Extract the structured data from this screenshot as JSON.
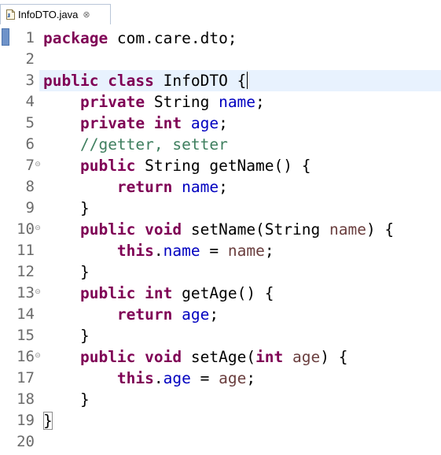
{
  "tab": {
    "label": "InfoDTO.java",
    "close_glyph": "⊗",
    "icon": "java-file-icon"
  },
  "editor": {
    "colors": {
      "keyword": "#7f0055",
      "field": "#0000c0",
      "parameter": "#6a3e3e",
      "comment": "#3f7f5f",
      "current_line": "#e8f2fe"
    },
    "lines": [
      {
        "number": "1",
        "tokens": [
          {
            "t": "package",
            "c": "keyword"
          },
          {
            "t": " com.care.dto;",
            "c": "plain"
          }
        ]
      },
      {
        "number": "2",
        "tokens": []
      },
      {
        "number": "3",
        "tokens": [
          {
            "t": "public",
            "c": "keyword"
          },
          {
            "t": " ",
            "c": "plain"
          },
          {
            "t": "class",
            "c": "keyword"
          },
          {
            "t": " InfoDTO {",
            "c": "plain"
          }
        ],
        "current": true,
        "caret": true
      },
      {
        "number": "4",
        "tokens": [
          {
            "t": "    ",
            "c": "plain"
          },
          {
            "t": "private",
            "c": "keyword"
          },
          {
            "t": " String ",
            "c": "plain"
          },
          {
            "t": "name",
            "c": "field"
          },
          {
            "t": ";",
            "c": "plain"
          }
        ]
      },
      {
        "number": "5",
        "tokens": [
          {
            "t": "    ",
            "c": "plain"
          },
          {
            "t": "private",
            "c": "keyword"
          },
          {
            "t": " ",
            "c": "plain"
          },
          {
            "t": "int",
            "c": "keyword"
          },
          {
            "t": " ",
            "c": "plain"
          },
          {
            "t": "age",
            "c": "field"
          },
          {
            "t": ";",
            "c": "plain"
          }
        ]
      },
      {
        "number": "6",
        "tokens": [
          {
            "t": "    ",
            "c": "plain"
          },
          {
            "t": "//getter, setter",
            "c": "comment"
          }
        ]
      },
      {
        "number": "7",
        "fold": true,
        "tokens": [
          {
            "t": "    ",
            "c": "plain"
          },
          {
            "t": "public",
            "c": "keyword"
          },
          {
            "t": " String getName() {",
            "c": "plain"
          }
        ]
      },
      {
        "number": "8",
        "tokens": [
          {
            "t": "        ",
            "c": "plain"
          },
          {
            "t": "return",
            "c": "keyword"
          },
          {
            "t": " ",
            "c": "plain"
          },
          {
            "t": "name",
            "c": "field"
          },
          {
            "t": ";",
            "c": "plain"
          }
        ]
      },
      {
        "number": "9",
        "tokens": [
          {
            "t": "    }",
            "c": "plain"
          }
        ]
      },
      {
        "number": "10",
        "fold": true,
        "tokens": [
          {
            "t": "    ",
            "c": "plain"
          },
          {
            "t": "public",
            "c": "keyword"
          },
          {
            "t": " ",
            "c": "plain"
          },
          {
            "t": "void",
            "c": "keyword"
          },
          {
            "t": " setName(String ",
            "c": "plain"
          },
          {
            "t": "name",
            "c": "param"
          },
          {
            "t": ") {",
            "c": "plain"
          }
        ]
      },
      {
        "number": "11",
        "tokens": [
          {
            "t": "        ",
            "c": "plain"
          },
          {
            "t": "this",
            "c": "keyword"
          },
          {
            "t": ".",
            "c": "plain"
          },
          {
            "t": "name",
            "c": "field"
          },
          {
            "t": " = ",
            "c": "plain"
          },
          {
            "t": "name",
            "c": "param"
          },
          {
            "t": ";",
            "c": "plain"
          }
        ]
      },
      {
        "number": "12",
        "tokens": [
          {
            "t": "    }",
            "c": "plain"
          }
        ]
      },
      {
        "number": "13",
        "fold": true,
        "tokens": [
          {
            "t": "    ",
            "c": "plain"
          },
          {
            "t": "public",
            "c": "keyword"
          },
          {
            "t": " ",
            "c": "plain"
          },
          {
            "t": "int",
            "c": "keyword"
          },
          {
            "t": " getAge() {",
            "c": "plain"
          }
        ]
      },
      {
        "number": "14",
        "tokens": [
          {
            "t": "        ",
            "c": "plain"
          },
          {
            "t": "return",
            "c": "keyword"
          },
          {
            "t": " ",
            "c": "plain"
          },
          {
            "t": "age",
            "c": "field"
          },
          {
            "t": ";",
            "c": "plain"
          }
        ]
      },
      {
        "number": "15",
        "tokens": [
          {
            "t": "    }",
            "c": "plain"
          }
        ]
      },
      {
        "number": "16",
        "fold": true,
        "tokens": [
          {
            "t": "    ",
            "c": "plain"
          },
          {
            "t": "public",
            "c": "keyword"
          },
          {
            "t": " ",
            "c": "plain"
          },
          {
            "t": "void",
            "c": "keyword"
          },
          {
            "t": " setAge(",
            "c": "plain"
          },
          {
            "t": "int",
            "c": "keyword"
          },
          {
            "t": " ",
            "c": "plain"
          },
          {
            "t": "age",
            "c": "param"
          },
          {
            "t": ") {",
            "c": "plain"
          }
        ]
      },
      {
        "number": "17",
        "tokens": [
          {
            "t": "        ",
            "c": "plain"
          },
          {
            "t": "this",
            "c": "keyword"
          },
          {
            "t": ".",
            "c": "plain"
          },
          {
            "t": "age",
            "c": "field"
          },
          {
            "t": " = ",
            "c": "plain"
          },
          {
            "t": "age",
            "c": "param"
          },
          {
            "t": ";",
            "c": "plain"
          }
        ]
      },
      {
        "number": "18",
        "tokens": [
          {
            "t": "    }",
            "c": "plain"
          }
        ]
      },
      {
        "number": "19",
        "tokens": [
          {
            "t": "}",
            "c": "bracket"
          }
        ]
      },
      {
        "number": "20",
        "tokens": []
      }
    ]
  }
}
